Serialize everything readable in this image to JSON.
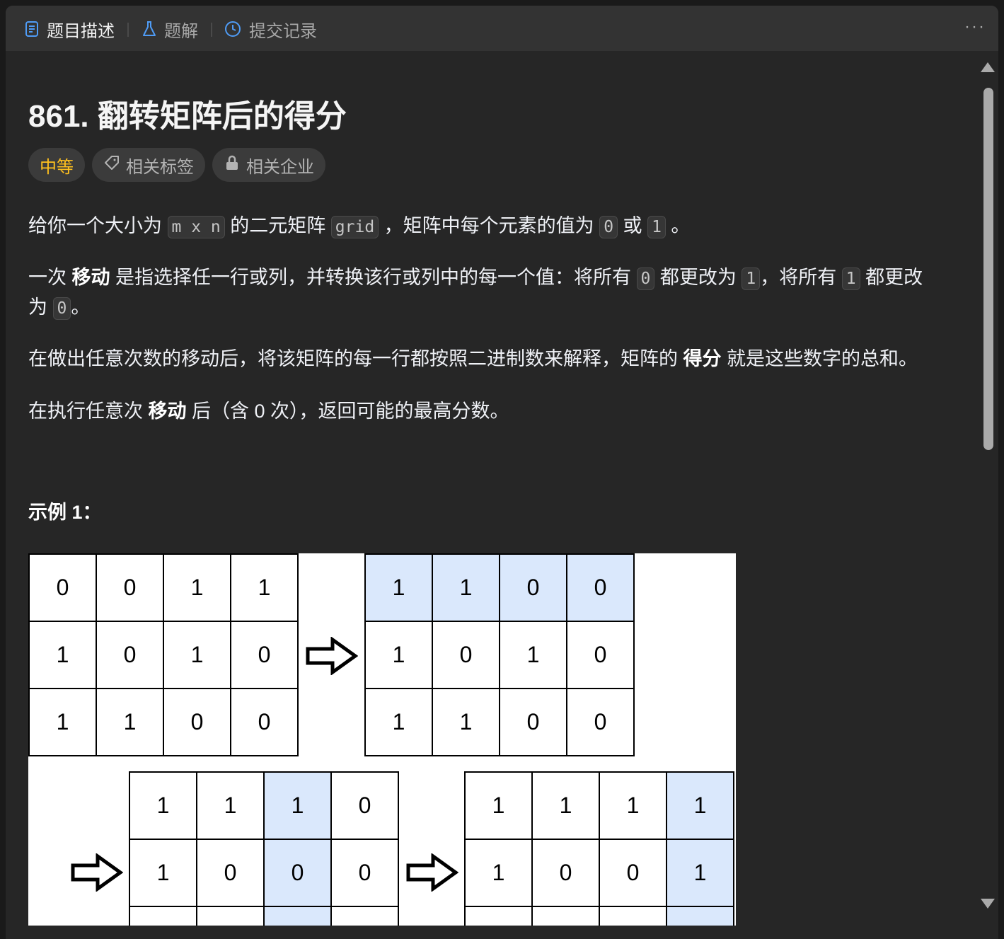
{
  "tabs": [
    {
      "label": "题目描述",
      "icon": "document-icon",
      "active": true
    },
    {
      "label": "题解",
      "icon": "flask-icon",
      "active": false
    },
    {
      "label": "提交记录",
      "icon": "history-icon",
      "active": false
    }
  ],
  "more_label": "···",
  "problem": {
    "title": "861. 翻转矩阵后的得分",
    "difficulty": "中等",
    "tags_label": "相关标签",
    "companies_label": "相关企业"
  },
  "description": {
    "p1": {
      "a": "给你一个大小为 ",
      "code1": "m x n",
      "b": " 的二元矩阵 ",
      "code2": "grid",
      "c": " ，矩阵中每个元素的值为 ",
      "code3": "0",
      "d": " 或 ",
      "code4": "1",
      "e": " 。"
    },
    "p2": {
      "a": "一次 ",
      "bold": "移动",
      "b": " 是指选择任一行或列，并转换该行或列中的每一个值：将所有 ",
      "code1": "0",
      "c": " 都更改为 ",
      "code2": "1",
      "d": "，将所有 ",
      "code3": "1",
      "e": " 都更改"
    },
    "p2_line2": {
      "a": "为 ",
      "code1": "0",
      "b": "。"
    },
    "p3": {
      "a": "在做出任意次数的移动后，将该矩阵的每一行都按照二进制数来解释，矩阵的 ",
      "bold": "得分",
      "b": " 就是这些数字的总和。"
    },
    "p4": {
      "a": "在执行任意次 ",
      "bold": "移动",
      "b": " 后（含 0 次），返回可能的最高分数。"
    }
  },
  "example_label": "示例 1：",
  "figure": {
    "grids": [
      {
        "cells": [
          [
            "0",
            "0",
            "1",
            "1"
          ],
          [
            "1",
            "0",
            "1",
            "0"
          ],
          [
            "1",
            "1",
            "0",
            "0"
          ]
        ],
        "highlight_rows": [],
        "highlight_cols": []
      },
      {
        "cells": [
          [
            "1",
            "1",
            "0",
            "0"
          ],
          [
            "1",
            "0",
            "1",
            "0"
          ],
          [
            "1",
            "1",
            "0",
            "0"
          ]
        ],
        "highlight_rows": [
          0
        ],
        "highlight_cols": []
      },
      {
        "cells": [
          [
            "1",
            "1",
            "1",
            "0"
          ],
          [
            "1",
            "0",
            "0",
            "0"
          ],
          [
            "",
            "",
            "",
            ""
          ]
        ],
        "highlight_rows": [],
        "highlight_cols": [
          2
        ]
      },
      {
        "cells": [
          [
            "1",
            "1",
            "1",
            "1"
          ],
          [
            "1",
            "0",
            "0",
            "1"
          ],
          [
            "",
            "",
            "",
            ""
          ]
        ],
        "highlight_rows": [],
        "highlight_cols": [
          3
        ]
      }
    ]
  },
  "colors": {
    "accent_medium": "#ffc01e",
    "highlight_cell": "#dae8fc",
    "panel_bg": "#262626"
  }
}
